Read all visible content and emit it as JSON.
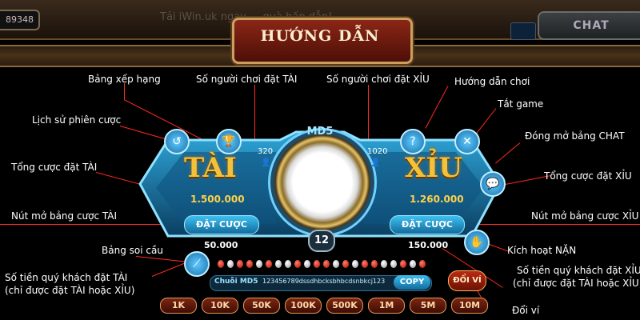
{
  "header": {
    "balance": "89348",
    "marquee": "Tải iWin.uk ngay ... quà hấp dẫn!",
    "chat_label": "CHAT",
    "title": "HƯỚNG DẪN"
  },
  "annotations": {
    "bang_xep_hang": "Bảng xếp hạng",
    "so_nguoi_tai": "Số người chơi đặt TÀI",
    "so_nguoi_xiu": "Số người chơi đặt XỈU",
    "huong_dan_choi": "Hướng dẫn chơi",
    "tat_game": "Tắt game",
    "lich_su": "Lịch sử phiên cược",
    "dong_mo_chat": "Đóng mở bảng CHAT",
    "tong_cuoc_tai": "Tổng cược đặt TÀI",
    "tong_cuoc_xiu": "Tổng cược đặt XỈU",
    "nut_mo_tai": "Nút mở bảng cược TÀI",
    "nut_mo_xiu": "Nút mở bảng cược XỈU",
    "bang_soi_cau": "Bảng soi cầu",
    "kich_hoat_nan": "Kích hoạt NẶN",
    "so_tien_tai_1": "Số tiền quý khách đặt TÀI",
    "so_tien_tai_2": "(chỉ được đặt TÀI hoặc XỈU)",
    "so_tien_xiu_1": "Số tiền quý khách đặt XỈU",
    "so_tien_xiu_2": "(chỉ được đặt TÀI hoặc XỈU)",
    "doi_vi": "Đổi ví"
  },
  "board": {
    "tai_label": "TÀI",
    "xiu_label": "XỈU",
    "tai_total": "1.500.000",
    "xiu_total": "1.260.000",
    "tai_players": "320",
    "xiu_players": "1020",
    "bet_button_tai": "ĐẶT CƯỢC",
    "bet_button_xiu": "ĐẶT CƯỢC",
    "tai_my_bet": "50.000",
    "xiu_my_bet": "150.000",
    "md5_label": "MD5",
    "timer": "12",
    "hash_label": "Chuỗi MD5",
    "hash_value": "123456789dssdhbcksbhbcdsnbkcj123",
    "copy_label": "COPY",
    "doi_vi_label": "ĐỔI VÍ"
  },
  "history_dots": [
    "red",
    "white",
    "red",
    "red",
    "white",
    "red",
    "white",
    "white",
    "red",
    "white",
    "red",
    "red",
    "white",
    "red",
    "white",
    "red",
    "red",
    "white",
    "white",
    "red",
    "white",
    "red"
  ],
  "chips": [
    "1K",
    "10K",
    "50K",
    "100K",
    "500K",
    "1M",
    "5M",
    "10M"
  ],
  "colors": {
    "accent_red_line": "#ff2b1e",
    "gold_text": "#f4c23a",
    "board_blue": "#1a6a94"
  }
}
